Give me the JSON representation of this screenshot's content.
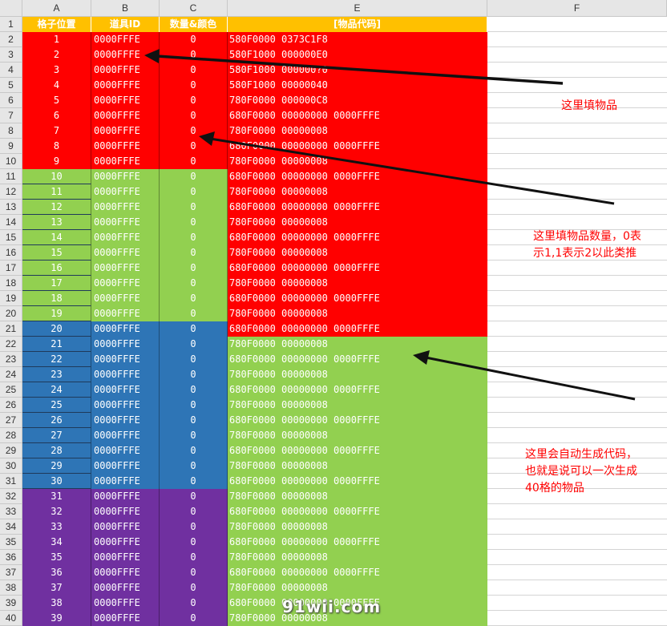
{
  "columns": [
    "A",
    "B",
    "C",
    "E",
    "F"
  ],
  "headers": {
    "a": "格子位置",
    "b": "道具ID",
    "c": "数量&颜色",
    "e": "[物品代码]"
  },
  "row_numbers": [
    "1",
    "2",
    "3",
    "4",
    "5",
    "6",
    "7",
    "8",
    "9",
    "10",
    "11",
    "12",
    "13",
    "14",
    "15",
    "16",
    "17",
    "18",
    "19",
    "20",
    "21",
    "22",
    "23",
    "24",
    "25",
    "26",
    "27",
    "28",
    "29",
    "30",
    "31",
    "32",
    "33",
    "34",
    "35",
    "36",
    "37",
    "38",
    "39",
    "40"
  ],
  "rows": [
    {
      "slot": "1",
      "id": "0000FFFE",
      "qty": "0",
      "code": "580F0000 0373C1F8"
    },
    {
      "slot": "2",
      "id": "0000FFFE",
      "qty": "0",
      "code": "580F1000 000000E0"
    },
    {
      "slot": "3",
      "id": "0000FFFE",
      "qty": "0",
      "code": "580F1000 000000?0"
    },
    {
      "slot": "4",
      "id": "0000FFFE",
      "qty": "0",
      "code": "580F1000 00000040"
    },
    {
      "slot": "5",
      "id": "0000FFFE",
      "qty": "0",
      "code": "780F0000 000000C8"
    },
    {
      "slot": "6",
      "id": "0000FFFE",
      "qty": "0",
      "code": "680F0000 00000000 0000FFFE"
    },
    {
      "slot": "7",
      "id": "0000FFFE",
      "qty": "0",
      "code": "780F0000 00000008"
    },
    {
      "slot": "8",
      "id": "0000FFFE",
      "qty": "0",
      "code": "680F0000 00000000 0000FFFE"
    },
    {
      "slot": "9",
      "id": "0000FFFE",
      "qty": "0",
      "code": "780F0000 00000008"
    },
    {
      "slot": "10",
      "id": "0000FFFE",
      "qty": "0",
      "code": "680F0000 00000000 0000FFFE"
    },
    {
      "slot": "11",
      "id": "0000FFFE",
      "qty": "0",
      "code": "780F0000 00000008"
    },
    {
      "slot": "12",
      "id": "0000FFFE",
      "qty": "0",
      "code": "680F0000 00000000 0000FFFE"
    },
    {
      "slot": "13",
      "id": "0000FFFE",
      "qty": "0",
      "code": "780F0000 00000008"
    },
    {
      "slot": "14",
      "id": "0000FFFE",
      "qty": "0",
      "code": "680F0000 00000000 0000FFFE"
    },
    {
      "slot": "15",
      "id": "0000FFFE",
      "qty": "0",
      "code": "780F0000 00000008"
    },
    {
      "slot": "16",
      "id": "0000FFFE",
      "qty": "0",
      "code": "680F0000 00000000 0000FFFE"
    },
    {
      "slot": "17",
      "id": "0000FFFE",
      "qty": "0",
      "code": "780F0000 00000008"
    },
    {
      "slot": "18",
      "id": "0000FFFE",
      "qty": "0",
      "code": "680F0000 00000000 0000FFFE"
    },
    {
      "slot": "19",
      "id": "0000FFFE",
      "qty": "0",
      "code": "780F0000 00000008"
    },
    {
      "slot": "20",
      "id": "0000FFFE",
      "qty": "0",
      "code": "680F0000 00000000 0000FFFE"
    },
    {
      "slot": "21",
      "id": "0000FFFE",
      "qty": "0",
      "code": "780F0000 00000008"
    },
    {
      "slot": "22",
      "id": "0000FFFE",
      "qty": "0",
      "code": "680F0000 00000000 0000FFFE"
    },
    {
      "slot": "23",
      "id": "0000FFFE",
      "qty": "0",
      "code": "780F0000 00000008"
    },
    {
      "slot": "24",
      "id": "0000FFFE",
      "qty": "0",
      "code": "680F0000 00000000 0000FFFE"
    },
    {
      "slot": "25",
      "id": "0000FFFE",
      "qty": "0",
      "code": "780F0000 00000008"
    },
    {
      "slot": "26",
      "id": "0000FFFE",
      "qty": "0",
      "code": "680F0000 00000000 0000FFFE"
    },
    {
      "slot": "27",
      "id": "0000FFFE",
      "qty": "0",
      "code": "780F0000 00000008"
    },
    {
      "slot": "28",
      "id": "0000FFFE",
      "qty": "0",
      "code": "680F0000 00000000 0000FFFE"
    },
    {
      "slot": "29",
      "id": "0000FFFE",
      "qty": "0",
      "code": "780F0000 00000008"
    },
    {
      "slot": "30",
      "id": "0000FFFE",
      "qty": "0",
      "code": "680F0000 00000000 0000FFFE"
    },
    {
      "slot": "31",
      "id": "0000FFFE",
      "qty": "0",
      "code": "780F0000 00000008"
    },
    {
      "slot": "32",
      "id": "0000FFFE",
      "qty": "0",
      "code": "680F0000 00000000 0000FFFE"
    },
    {
      "slot": "33",
      "id": "0000FFFE",
      "qty": "0",
      "code": "780F0000 00000008"
    },
    {
      "slot": "34",
      "id": "0000FFFE",
      "qty": "0",
      "code": "680F0000 00000000 0000FFFE"
    },
    {
      "slot": "35",
      "id": "0000FFFE",
      "qty": "0",
      "code": "780F0000 00000008"
    },
    {
      "slot": "36",
      "id": "0000FFFE",
      "qty": "0",
      "code": "680F0000 00000000 0000FFFE"
    },
    {
      "slot": "37",
      "id": "0000FFFE",
      "qty": "0",
      "code": "780F0000 00000008"
    },
    {
      "slot": "38",
      "id": "0000FFFE",
      "qty": "0",
      "code": "680F0000 00000000 0000FFFE"
    },
    {
      "slot": "39",
      "id": "0000FFFE",
      "qty": "0",
      "code": "780F0000 00000008"
    }
  ],
  "annotations": {
    "fill_item": "这里填物品",
    "fill_qty": "这里填物品数量，0表\n示1,1表示2以此类推",
    "auto_gen": "这里会自动生成代码，\n也就是说可以一次生成\n40格的物品"
  },
  "watermark": "91wii.com",
  "colors": {
    "header": "#ffc000",
    "red": "#ff0000",
    "green": "#92d050",
    "blue": "#2e75b6",
    "purple": "#7030a0",
    "annotation": "#ff0000"
  }
}
